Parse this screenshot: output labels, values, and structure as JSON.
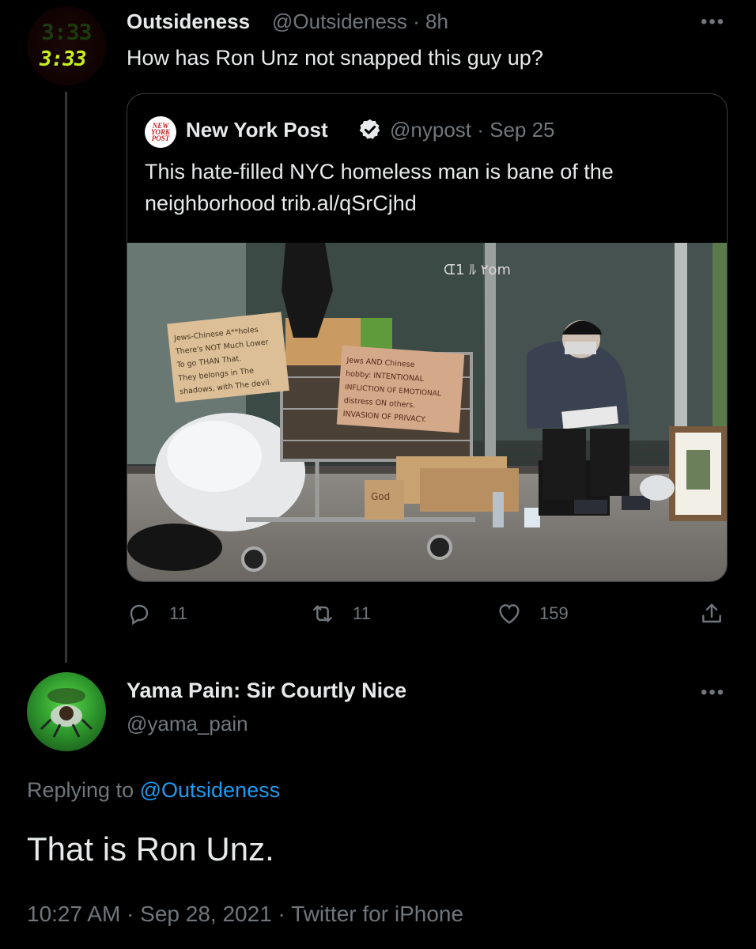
{
  "parent": {
    "avatar_clock_faint": "3:33",
    "avatar_clock": "3:33",
    "display_name": "Outsideness",
    "meta": "@Outsideness · 8h",
    "more": "•••",
    "text": "How has Ron Unz not snapped this guy up?",
    "quote": {
      "logo_text": "NEW YORK POST",
      "display_name": "New York Post",
      "meta": "@nypost · Sep 25",
      "text": "This hate-filled NYC homeless man is bane of the neighborhood trib.al/qSrCjhd",
      "image": {
        "sign_left": [
          "Jews-Chinese A**holes",
          "There's NOT Much Lower",
          "To go THAN That.",
          "They belongs in The",
          "shadows, with The devil."
        ],
        "sign_right": [
          "Jews AND Chinese",
          "hobby: INTENTIONAL",
          "INFLICTION OF EMOTIONAL",
          "distress ON others.",
          "INVASION OF PRIVACY."
        ],
        "sign_bottom": "God"
      }
    },
    "actions": {
      "reply_count": "11",
      "retweet_count": "11",
      "like_count": "159"
    }
  },
  "reply": {
    "display_name": "Yama Pain: Sir Courtly Nice",
    "handle": "@yama_pain",
    "more": "•••",
    "replying_prefix": "Replying to ",
    "replying_to": "@Outsideness",
    "text": "That is Ron Unz.",
    "footer": "10:27 AM · Sep 28, 2021 · Twitter for iPhone"
  },
  "colors": {
    "background": "#000000",
    "text": "#e7e9ea",
    "secondary": "#71767b",
    "link": "#1d9bf0",
    "clock_green": "#c8ef1e"
  }
}
